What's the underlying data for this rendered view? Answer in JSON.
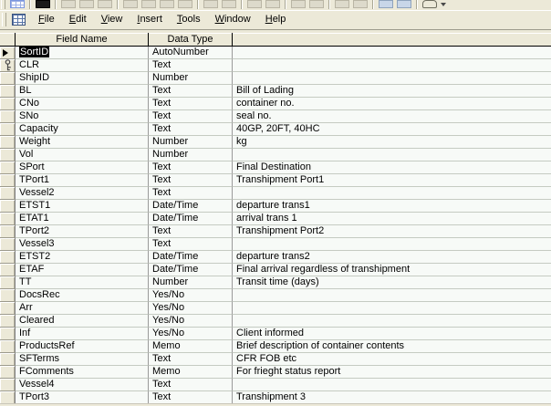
{
  "app": {
    "context": "table-design-view"
  },
  "toolbar": {
    "icons": [
      "table-view",
      "separator",
      "save",
      "separator",
      "print",
      "print-preview",
      "spelling",
      "separator",
      "cut",
      "copy",
      "paste",
      "format-painter",
      "separator",
      "undo",
      "insert-hyperlink",
      "separator",
      "primary-key",
      "indexes",
      "separator",
      "insert-rows",
      "delete-rows",
      "separator",
      "properties",
      "build",
      "separator",
      "database-window",
      "new-object",
      "separator",
      "help"
    ]
  },
  "menu": {
    "items": [
      "File",
      "Edit",
      "View",
      "Insert",
      "Tools",
      "Window",
      "Help"
    ]
  },
  "grid": {
    "headers": {
      "selector": "",
      "field_name": "Field Name",
      "data_type": "Data Type",
      "description": ""
    },
    "rows": [
      {
        "field": "SortID",
        "type": "AutoNumber",
        "desc": "",
        "marker": "current",
        "selected": true
      },
      {
        "field": "CLR",
        "type": "Text",
        "desc": "",
        "marker": "key"
      },
      {
        "field": "ShipID",
        "type": "Number",
        "desc": ""
      },
      {
        "field": "BL",
        "type": "Text",
        "desc": "Bill of Lading"
      },
      {
        "field": "CNo",
        "type": "Text",
        "desc": "container no."
      },
      {
        "field": "SNo",
        "type": "Text",
        "desc": "seal no."
      },
      {
        "field": "Capacity",
        "type": "Text",
        "desc": "40GP, 20FT, 40HC"
      },
      {
        "field": "Weight",
        "type": "Number",
        "desc": "kg"
      },
      {
        "field": "Vol",
        "type": "Number",
        "desc": ""
      },
      {
        "field": "SPort",
        "type": "Text",
        "desc": "Final Destination"
      },
      {
        "field": "TPort1",
        "type": "Text",
        "desc": "Transhipment Port1"
      },
      {
        "field": "Vessel2",
        "type": "Text",
        "desc": ""
      },
      {
        "field": "ETST1",
        "type": "Date/Time",
        "desc": "departure trans1"
      },
      {
        "field": "ETAT1",
        "type": "Date/Time",
        "desc": "arrival trans 1"
      },
      {
        "field": "TPort2",
        "type": "Text",
        "desc": "Transhipment Port2"
      },
      {
        "field": "Vessel3",
        "type": "Text",
        "desc": ""
      },
      {
        "field": "ETST2",
        "type": "Date/Time",
        "desc": "departure trans2"
      },
      {
        "field": "ETAF",
        "type": "Date/Time",
        "desc": "Final arrival regardless of transhipment"
      },
      {
        "field": "TT",
        "type": "Number",
        "desc": "Transit time (days)"
      },
      {
        "field": "DocsRec",
        "type": "Yes/No",
        "desc": ""
      },
      {
        "field": "Arr",
        "type": "Yes/No",
        "desc": ""
      },
      {
        "field": "Cleared",
        "type": "Yes/No",
        "desc": ""
      },
      {
        "field": "Inf",
        "type": "Yes/No",
        "desc": "Client informed"
      },
      {
        "field": "ProductsRef",
        "type": "Memo",
        "desc": "Brief description of container contents"
      },
      {
        "field": "SFTerms",
        "type": "Text",
        "desc": "CFR FOB etc"
      },
      {
        "field": "FComments",
        "type": "Memo",
        "desc": "For frieght status report"
      },
      {
        "field": "Vessel4",
        "type": "Text",
        "desc": ""
      },
      {
        "field": "TPort3",
        "type": "Text",
        "desc": "Transhipment 3"
      }
    ]
  },
  "colors": {
    "chrome_bg": "#ECE9D8",
    "grid_bg": "#F7FAF7",
    "gridline_horizontal": "#C5CBC2",
    "gridline_vertical": "#9A9A9A",
    "header_border": "#000000",
    "selection_bg": "#000000",
    "selection_fg": "#FFFFFF"
  }
}
